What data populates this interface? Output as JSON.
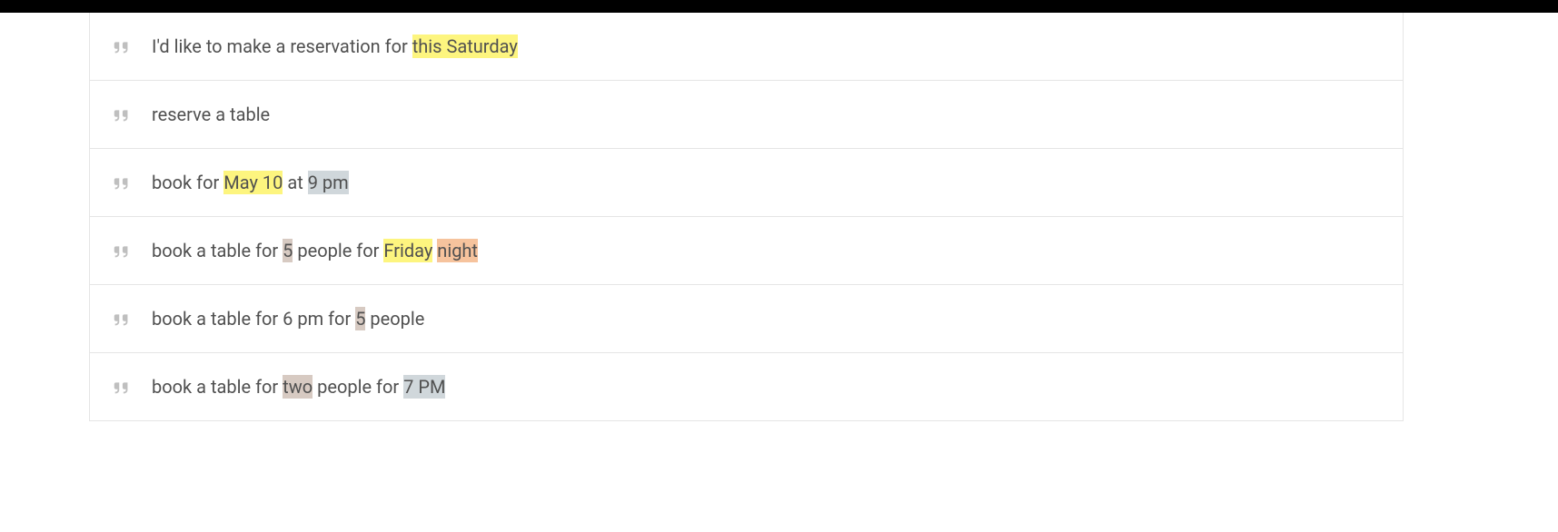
{
  "highlightClasses": {
    "yellow": "hl-yellow",
    "gray": "hl-gray",
    "taupe": "hl-taupe",
    "orange": "hl-orange"
  },
  "rows": [
    {
      "segments": [
        {
          "text": "I'd like to make a reservation for "
        },
        {
          "text": "this Saturday",
          "hl": "yellow"
        }
      ]
    },
    {
      "segments": [
        {
          "text": "reserve a table"
        }
      ]
    },
    {
      "segments": [
        {
          "text": "book for "
        },
        {
          "text": "May 10",
          "hl": "yellow"
        },
        {
          "text": " at "
        },
        {
          "text": "9 pm",
          "hl": "gray"
        }
      ]
    },
    {
      "segments": [
        {
          "text": "book a table for "
        },
        {
          "text": "5",
          "hl": "taupe"
        },
        {
          "text": " people for "
        },
        {
          "text": "Friday",
          "hl": "yellow"
        },
        {
          "text": " "
        },
        {
          "text": "night",
          "hl": "orange"
        }
      ]
    },
    {
      "segments": [
        {
          "text": "book a table for 6 pm for "
        },
        {
          "text": "5",
          "hl": "taupe"
        },
        {
          "text": " people"
        }
      ]
    },
    {
      "segments": [
        {
          "text": "book a table for "
        },
        {
          "text": "two",
          "hl": "taupe"
        },
        {
          "text": " people for "
        },
        {
          "text": "7 PM",
          "hl": "gray"
        }
      ]
    }
  ]
}
